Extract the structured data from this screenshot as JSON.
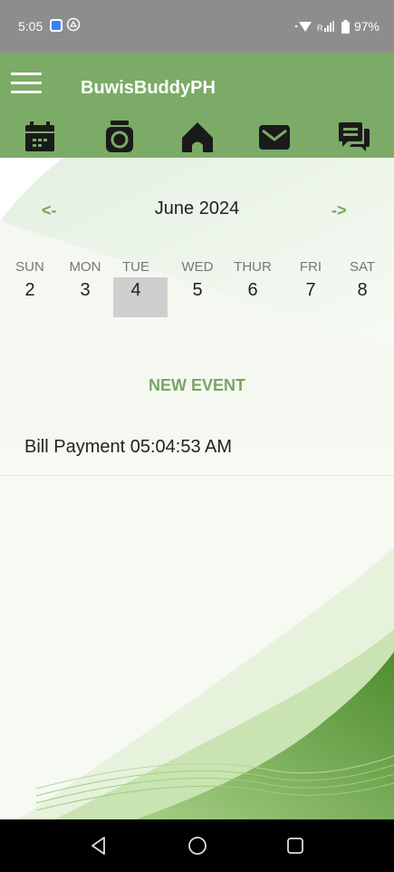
{
  "status_bar": {
    "time": "5:05",
    "battery": "97%",
    "icons": [
      "app-notification-icon",
      "drive-icon",
      "wifi-icon",
      "signal-icon",
      "battery-icon"
    ]
  },
  "app_bar": {
    "title": "BuwisBuddyPH",
    "menu_icon": "hamburger-menu-icon",
    "toolbar": [
      "calendar-icon",
      "camera-icon",
      "home-icon",
      "mail-icon",
      "chat-icon"
    ]
  },
  "calendar": {
    "prev_label": "<-",
    "month_title": "June 2024",
    "next_label": "->",
    "days": [
      {
        "name": "SUN",
        "num": "2"
      },
      {
        "name": "MON",
        "num": "3"
      },
      {
        "name": "TUE",
        "num": "4",
        "selected": true
      },
      {
        "name": "WED",
        "num": "5"
      },
      {
        "name": "THUR",
        "num": "6"
      },
      {
        "name": "FRI",
        "num": "7"
      },
      {
        "name": "SAT",
        "num": "8"
      }
    ]
  },
  "events": {
    "new_event_label": "NEW EVENT",
    "items": [
      {
        "text": "Bill Payment 05:04:53 AM"
      }
    ]
  },
  "nav_bar": {
    "buttons": [
      "back-icon",
      "home-circle-icon",
      "recents-icon"
    ]
  },
  "colors": {
    "accent_green": "#7bab66",
    "status_gray": "#8d8d8d",
    "selected_day": "#cfcfcf"
  }
}
